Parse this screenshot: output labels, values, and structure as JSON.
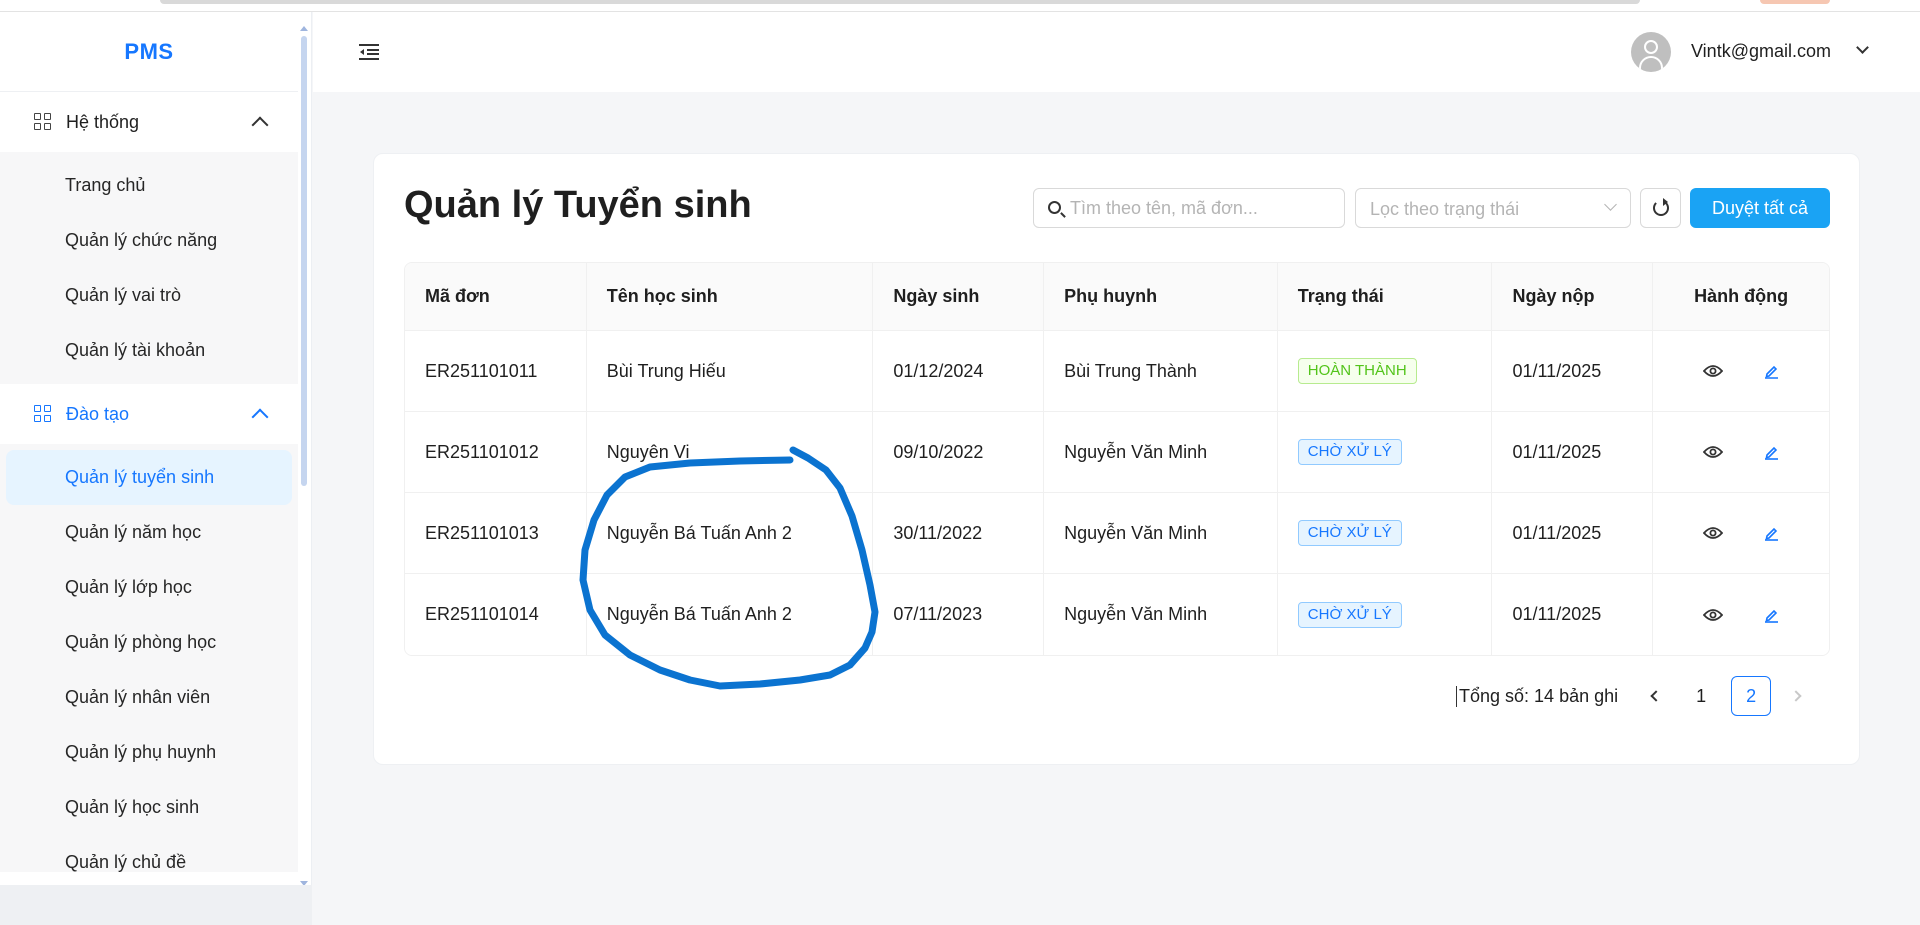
{
  "sidebar": {
    "brand": "PMS",
    "groups": [
      {
        "label": "Hệ thống",
        "items": [
          "Trang chủ",
          "Quản lý chức năng",
          "Quản lý vai trò",
          "Quản lý tài khoản"
        ]
      },
      {
        "label": "Đào tạo",
        "items": [
          "Quản lý tuyển sinh",
          "Quản lý năm học",
          "Quản lý lớp học",
          "Quản lý phòng học",
          "Quản lý nhân viên",
          "Quản lý phụ huynh",
          "Quản lý học sinh",
          "Quản lý chủ đề"
        ]
      }
    ]
  },
  "header": {
    "user_email": "Vintk@gmail.com"
  },
  "main": {
    "title": "Quản lý Tuyển sinh",
    "search_placeholder": "Tìm theo tên, mã đơn...",
    "filter_placeholder": "Lọc theo trạng thái",
    "approve_all_label": "Duyệt tất cả",
    "table": {
      "columns": [
        "Mã đơn",
        "Tên học sinh",
        "Ngày sinh",
        "Phụ huynh",
        "Trạng thái",
        "Ngày nộp",
        "Hành động"
      ],
      "rows": [
        {
          "id": "ER251101011",
          "name": "Bùi Trung Hiếu",
          "dob": "01/12/2024",
          "parent": "Bùi Trung Thành",
          "status": "HOÀN THÀNH",
          "submitted": "01/11/2025"
        },
        {
          "id": "ER251101012",
          "name": "Nguyên Vi",
          "dob": "09/10/2022",
          "parent": "Nguyễn Văn Minh",
          "status": "CHỜ XỬ LÝ",
          "submitted": "01/11/2025"
        },
        {
          "id": "ER251101013",
          "name": "Nguyễn Bá Tuấn Anh 2",
          "dob": "30/11/2022",
          "parent": "Nguyễn Văn Minh",
          "status": "CHỜ XỬ LÝ",
          "submitted": "01/11/2025"
        },
        {
          "id": "ER251101014",
          "name": "Nguyễn Bá Tuấn Anh 2",
          "dob": "07/11/2023",
          "parent": "Nguyễn Văn Minh",
          "status": "CHỜ XỬ LÝ",
          "submitted": "01/11/2025"
        }
      ]
    },
    "pagination": {
      "total_text": "Tổng số: 14 bản ghi",
      "pages": [
        "1",
        "2"
      ],
      "current_page": "2"
    }
  },
  "colors": {
    "accent": "#1677ff",
    "primary_button": "#1aa3f4",
    "done_badge": "#52c41a",
    "annotation_stroke": "#0b73d0"
  },
  "icons": [
    "menu-fold-icon",
    "user-avatar-icon",
    "chevron-down-icon",
    "grid-icon",
    "chevron-up-icon",
    "search-icon",
    "reload-icon",
    "eye-icon",
    "edit-icon",
    "chevron-left-icon",
    "chevron-right-icon"
  ]
}
